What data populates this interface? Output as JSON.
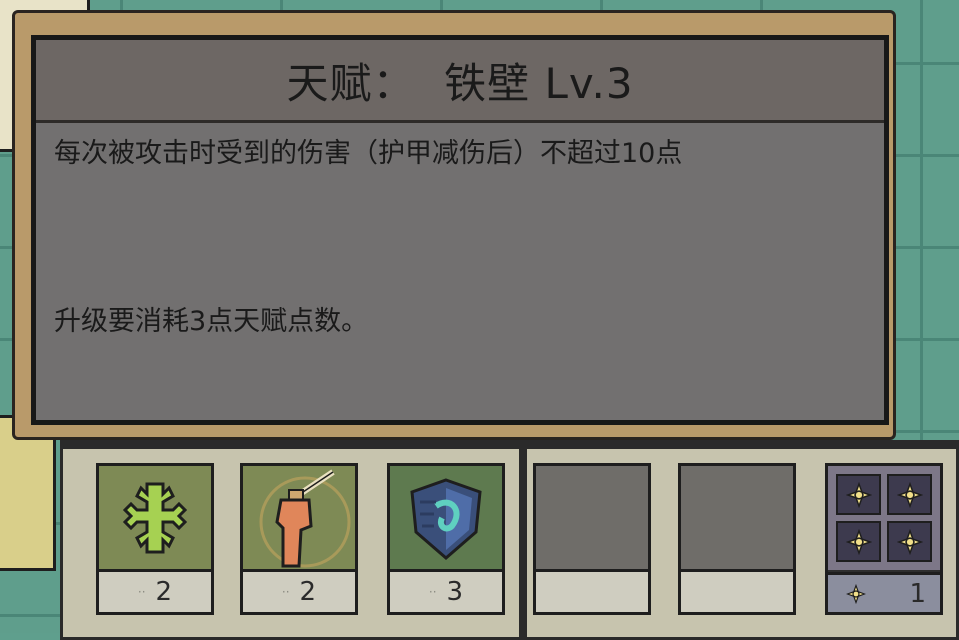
{
  "dialog": {
    "title": "天赋：  铁壁 Lv.3",
    "description": "每次被攻击时受到的伤害（护甲减伤后）不超过10点",
    "upgrade_cost": "升级要消耗3点天赋点数。"
  },
  "skill_slots": [
    {
      "icon": "green-cross-icon",
      "count": "2",
      "face_color": "#7e8a55"
    },
    {
      "icon": "sword-fist-icon",
      "count": "2",
      "face_color": "#7e8a55"
    },
    {
      "icon": "shield-icon",
      "count": "3",
      "face_color": "#5e7a4f"
    },
    {
      "icon": "empty",
      "count": "",
      "face_color": "#6f6d69"
    },
    {
      "icon": "empty",
      "count": "",
      "face_color": "#6f6d69"
    }
  ],
  "talent_points": {
    "icon": "star-gem-icon",
    "count": "1"
  }
}
